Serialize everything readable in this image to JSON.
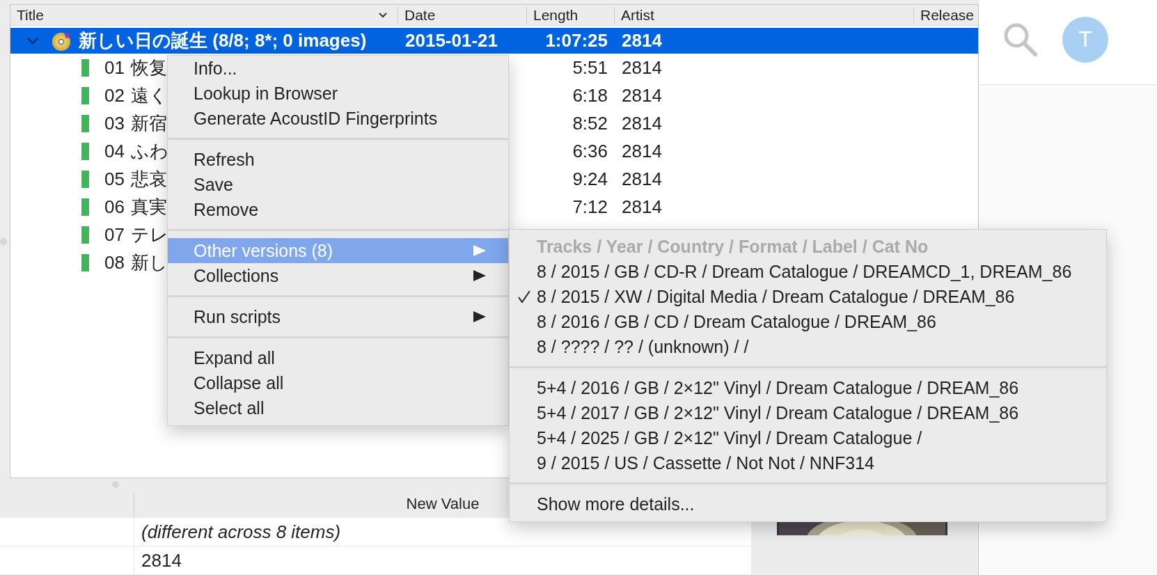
{
  "table": {
    "columns": [
      {
        "label": "Title",
        "has_dropdown": true
      },
      {
        "label": "Date"
      },
      {
        "label": "Length"
      },
      {
        "label": "Artist"
      },
      {
        "label": "Release"
      }
    ],
    "album": {
      "title": "新しい日の誕生 (8/8; 8*; 0 images)",
      "date": "2015-01-21",
      "length": "1:07:25",
      "artist": "2814",
      "selected": true,
      "expanded": true,
      "tracks": [
        {
          "number": "01",
          "title": "恢复",
          "length": "5:51",
          "artist": "2814"
        },
        {
          "number": "02",
          "title": "遠く",
          "length": "6:18",
          "artist": "2814"
        },
        {
          "number": "03",
          "title": "新宿",
          "length": "8:52",
          "artist": "2814"
        },
        {
          "number": "04",
          "title": "ふわ",
          "length": "6:36",
          "artist": "2814"
        },
        {
          "number": "05",
          "title": "悲哀",
          "length": "9:24",
          "artist": "2814"
        },
        {
          "number": "06",
          "title": "真実",
          "length": "7:12",
          "artist": "2814"
        },
        {
          "number": "07",
          "title": "テレ"
        },
        {
          "number": "08",
          "title": "新し"
        }
      ]
    }
  },
  "context_menu": {
    "items": [
      {
        "kind": "item",
        "label": "Info...",
        "selected": false
      },
      {
        "kind": "item",
        "label": "Lookup in Browser",
        "selected": false
      },
      {
        "kind": "item",
        "label": "Generate AcoustID Fingerprints",
        "selected": false
      },
      {
        "kind": "separator"
      },
      {
        "kind": "item",
        "label": "Refresh",
        "selected": false
      },
      {
        "kind": "item",
        "label": "Save",
        "selected": false
      },
      {
        "kind": "item",
        "label": "Remove",
        "selected": false
      },
      {
        "kind": "separator"
      },
      {
        "kind": "submenu",
        "label": "Other versions (8)",
        "selected": true
      },
      {
        "kind": "submenu",
        "label": "Collections",
        "selected": false
      },
      {
        "kind": "separator"
      },
      {
        "kind": "submenu",
        "label": "Run scripts",
        "selected": false
      },
      {
        "kind": "separator"
      },
      {
        "kind": "item",
        "label": "Expand all",
        "selected": false
      },
      {
        "kind": "item",
        "label": "Collapse all",
        "selected": false
      },
      {
        "kind": "item",
        "label": "Select all",
        "selected": false
      }
    ]
  },
  "submenu": {
    "items": [
      {
        "kind": "item",
        "label": "Tracks / Year / Country / Format / Label / Cat No",
        "disabled": true,
        "checked": false
      },
      {
        "kind": "item",
        "label": "8 / 2015 / GB / CD-R / Dream Catalogue / DREAMCD_1, DREAM_86",
        "disabled": false,
        "checked": false
      },
      {
        "kind": "item",
        "label": "8 / 2015 / XW / Digital Media / Dream Catalogue / DREAM_86",
        "disabled": false,
        "checked": true
      },
      {
        "kind": "item",
        "label": "8 / 2016 / GB / CD / Dream Catalogue / DREAM_86",
        "disabled": false,
        "checked": false
      },
      {
        "kind": "item",
        "label": "8 / ???? / ?? / (unknown) /  /",
        "disabled": false,
        "checked": false
      },
      {
        "kind": "separator"
      },
      {
        "kind": "item",
        "label": "5+4 / 2016 / GB / 2×12\" Vinyl / Dream Catalogue / DREAM_86",
        "disabled": false,
        "checked": false
      },
      {
        "kind": "item",
        "label": "5+4 / 2017 / GB / 2×12\" Vinyl / Dream Catalogue / DREAM_86",
        "disabled": false,
        "checked": false
      },
      {
        "kind": "item",
        "label": "5+4 / 2025 / GB / 2×12\" Vinyl / Dream Catalogue /",
        "disabled": false,
        "checked": false
      },
      {
        "kind": "item",
        "label": "9 / 2015 / US / Cassette / Not Not / NNF314",
        "disabled": false,
        "checked": false
      },
      {
        "kind": "separator"
      },
      {
        "kind": "item",
        "label": "Show more details...",
        "disabled": false,
        "checked": false
      }
    ]
  },
  "metadata": {
    "columns": [
      {
        "label": "New Value"
      }
    ],
    "rows": [
      {
        "value": "(different across 8 items)",
        "varies": true
      },
      {
        "value": "2814",
        "varies": false
      }
    ]
  },
  "account": {
    "initial": "T"
  }
}
